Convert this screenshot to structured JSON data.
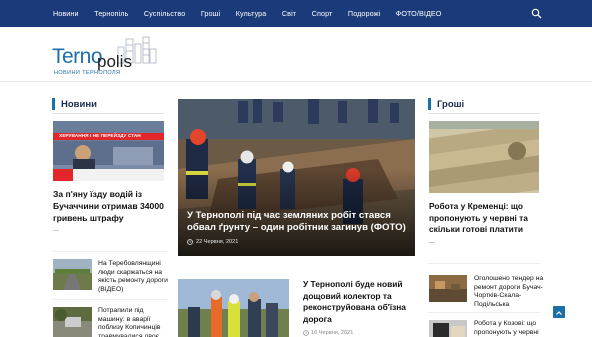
{
  "nav": {
    "items": [
      "Новини",
      "Тернопіль",
      "Суспільство",
      "Гроші",
      "Культура",
      "Світ",
      "Спорт",
      "Подорожі",
      "ФОТО/ВІДЕО"
    ]
  },
  "logo": {
    "part1": "Terno",
    "part2": "polis",
    "subtitle": "НОВИНИ ТЕРНОПОЛЯ"
  },
  "sections": {
    "news": "Новини",
    "money": "Гроші"
  },
  "left": {
    "tv_caption": "ХЕРУВАННЯ І НЕ ПЕРЕЙЗДУ СТАН",
    "main_title": "За п'яну їзду водій із Бучаччини отримав 34000 гривень штрафу",
    "dash": "...",
    "items": [
      {
        "title": "На Теребовлянщині люди скаржаться на якість ремонту дороги (ВІДЕО)"
      },
      {
        "title": "Потрапили під машину: в аварії поблизу Копичинців травмувалися двоє"
      }
    ]
  },
  "center": {
    "feature_title": "У Тернополі під час земляних робіт стався обвал ґрунту – один робітник загинув (ФОТО)",
    "feature_date": "22 Червня, 2021",
    "second_title": "У Тернополі буде новий дощовий колектор та реконструйована об'їзна дорога",
    "second_date": "16 Червня, 2021"
  },
  "right": {
    "main_title": "Робота у Кременці: що пропонують у червні та скільки готові платити",
    "dash": "...",
    "items": [
      {
        "title": "Оголошено тендер на ремонт дороги Бучач-Чортків-Скала-Подільська"
      },
      {
        "title": "Робота у Козові: що пропонують у червні"
      }
    ]
  },
  "colors": {
    "nav_bg": "#1a3a7a",
    "accent": "#1d6fa8"
  }
}
